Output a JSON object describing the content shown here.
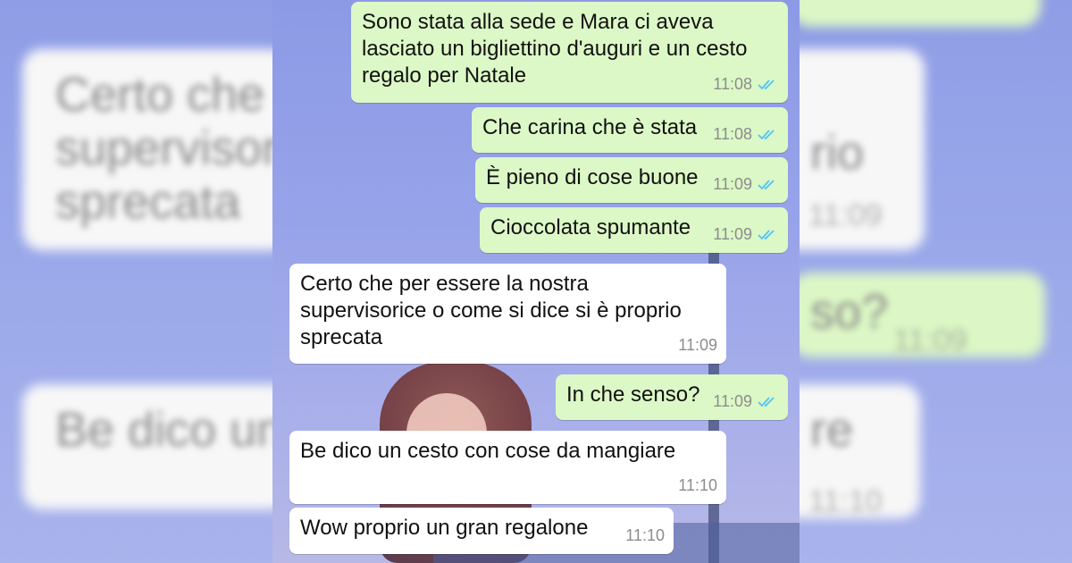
{
  "background": {
    "left_blur": [
      "Certo che p",
      "supervisor",
      "sprecata",
      "Be dico un"
    ],
    "right_blur": [
      "rio",
      "11:09",
      "so?",
      "11:09",
      "re",
      "11:10"
    ]
  },
  "messages": [
    {
      "text": "Sono stata alla sede e Mara ci aveva\nlasciato un bigliettino d'auguri e un cesto\nregalo per Natale",
      "time": "11:08",
      "direction": "out",
      "read": true
    },
    {
      "text": "Che carina che è stata",
      "time": "11:08",
      "direction": "out",
      "read": true
    },
    {
      "text": "È pieno di cose buone",
      "time": "11:09",
      "direction": "out",
      "read": true
    },
    {
      "text": "Cioccolata spumante",
      "time": "11:09",
      "direction": "out",
      "read": true
    },
    {
      "text": "Certo che per essere la nostra\nsupervisoricе o come si dice si è proprio\nsprecata",
      "time": "11:09",
      "direction": "in",
      "read": false
    },
    {
      "text": "In che senso?",
      "time": "11:09",
      "direction": "out",
      "read": true
    },
    {
      "text": "Be dico un cesto con cose da mangiare",
      "time": "11:10",
      "direction": "in",
      "read": false
    },
    {
      "text": "Wow proprio un gran regalone",
      "time": "11:10",
      "direction": "in",
      "read": false
    }
  ],
  "colors": {
    "outgoing": "#dcf8c6",
    "incoming": "#ffffff",
    "read_ticks": "#4fc3f7"
  },
  "icons": {
    "read_receipt": "double-check-icon"
  }
}
